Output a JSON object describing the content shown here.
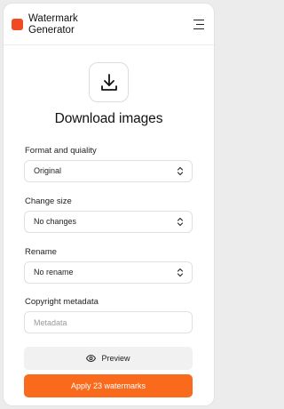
{
  "header": {
    "brand_line1": "Watermark",
    "brand_line2": "Generator",
    "logo_color": "#f14a22",
    "menu_icon": "hamburger-menu-icon"
  },
  "main": {
    "download_icon": "download-icon",
    "title": "Download images"
  },
  "form": {
    "format": {
      "label": "Format and quiality",
      "value": "Original"
    },
    "size": {
      "label": "Change size",
      "value": "No changes"
    },
    "rename": {
      "label": "Rename",
      "value": "No rename"
    },
    "metadata": {
      "label": "Copyright metadata",
      "placeholder": "Metadata",
      "value": ""
    }
  },
  "actions": {
    "preview_label": "Preview",
    "preview_icon": "eye-icon",
    "apply_label": "Apply 23 watermarks",
    "apply_color": "#fa6a1c"
  }
}
